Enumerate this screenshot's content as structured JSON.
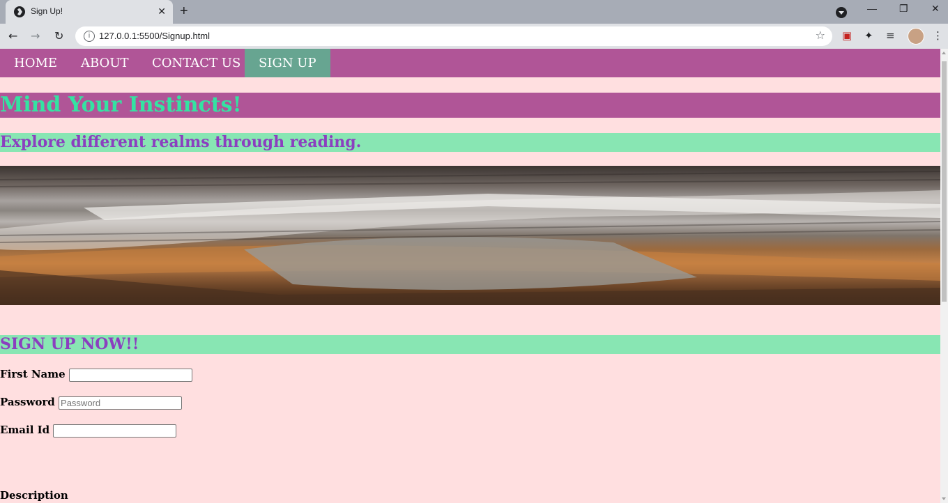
{
  "browser": {
    "tab_title": "Sign Up!",
    "url": "127.0.0.1:5500/Signup.html"
  },
  "nav": {
    "items": [
      {
        "label": "HOME"
      },
      {
        "label": "ABOUT"
      },
      {
        "label": "CONTACT US"
      },
      {
        "label": "SIGN UP"
      }
    ],
    "active_color": "#67a591",
    "bar_color": "#b05597"
  },
  "headings": {
    "h1": "Mind Your Instincts!",
    "h2": "Explore different realms through reading.",
    "signup": "SIGN UP NOW!!"
  },
  "form": {
    "first_name_label": "First Name",
    "first_name_value": "",
    "password_label": "Password",
    "password_placeholder": "Password",
    "email_label": "Email Id",
    "email_value": "",
    "description_label": "Description"
  },
  "icons": {
    "back": "arrow-left-icon",
    "forward": "arrow-right-icon",
    "reload": "reload-icon",
    "star": "star-icon",
    "extensions": "puzzle-icon"
  }
}
